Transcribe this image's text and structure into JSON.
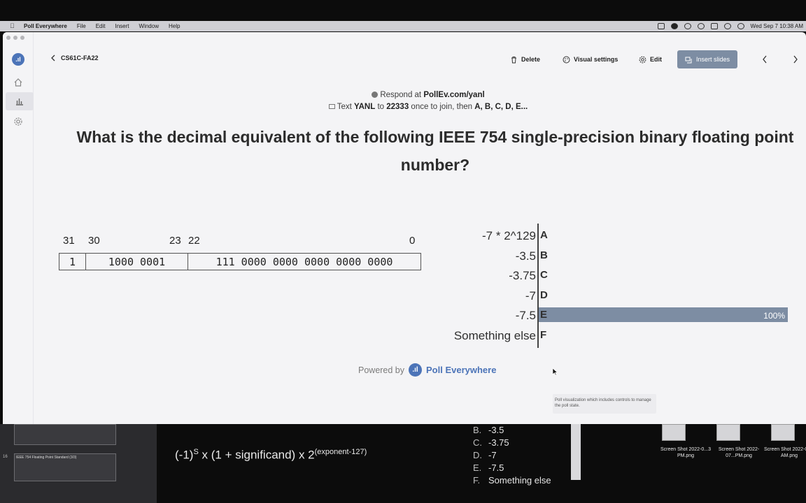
{
  "menubar": {
    "app": "Poll Everywhere",
    "items": [
      "File",
      "Edit",
      "Insert",
      "Window",
      "Help"
    ],
    "clock": "Wed Sep 7  10:38 AM"
  },
  "topbar": {
    "back_label": "CS61C-FA22",
    "delete_label": "Delete",
    "visual_settings_label": "Visual settings",
    "edit_label": "Edit",
    "insert_slides_label": "Insert slides"
  },
  "slide": {
    "respond_prefix": "Respond at ",
    "respond_url": "PollEv.com/yanl",
    "text_prefix": "Text ",
    "text_code": "YANL",
    "text_to": " to ",
    "text_number": "22333",
    "text_suffix": " once to join, then ",
    "text_options": "A, B, C, D, E...",
    "question": "What is the decimal equivalent of the following IEEE 754 single-precision binary floating point number?",
    "bit_labels": {
      "b31": "31",
      "b30": "30",
      "b23": "23",
      "b22": "22",
      "b0": "0"
    },
    "bit_fields": {
      "sign": "1",
      "exponent": "1000 0001",
      "significand": "111 0000 0000 0000 0000 0000"
    },
    "powered_by": "Powered by",
    "brand": "Poll Everywhere",
    "tooltip": "Poll visualization which includes controls to manage the poll state."
  },
  "chart_data": {
    "type": "bar",
    "orientation": "horizontal",
    "categories": [
      "-7 * 2^129",
      "-3.5",
      "-3.75",
      "-7",
      "-7.5",
      "Something else"
    ],
    "letters": [
      "A",
      "B",
      "C",
      "D",
      "E",
      "F"
    ],
    "values": [
      0,
      0,
      0,
      0,
      100,
      0
    ],
    "labels": [
      "",
      "",
      "",
      "",
      "100%",
      ""
    ],
    "unit": "%",
    "xlim": [
      0,
      100
    ],
    "bar_color": "#7d8da3"
  },
  "background": {
    "slide_16_title": "IEEE 754 Floating Point Standard (3/3)",
    "slide_16_num": "16",
    "formula_base": "(-1)",
    "formula_s": "S",
    "formula_mid": " x (1 + significand) x 2",
    "formula_exp": "(exponent-127)",
    "options": [
      {
        "k": "B.",
        "v": "-3.5"
      },
      {
        "k": "C.",
        "v": "-3.75"
      },
      {
        "k": "D.",
        "v": "-7"
      },
      {
        "k": "E.",
        "v": "-7.5"
      },
      {
        "k": "F.",
        "v": "Something else"
      }
    ],
    "screenshots": [
      {
        "label": "Screen Shot 2022-0...3 PM.png"
      },
      {
        "label": "Screen Shot 2022-07...PM.png"
      },
      {
        "label": "Screen Shot 2022-0...9 AM.png"
      }
    ]
  }
}
